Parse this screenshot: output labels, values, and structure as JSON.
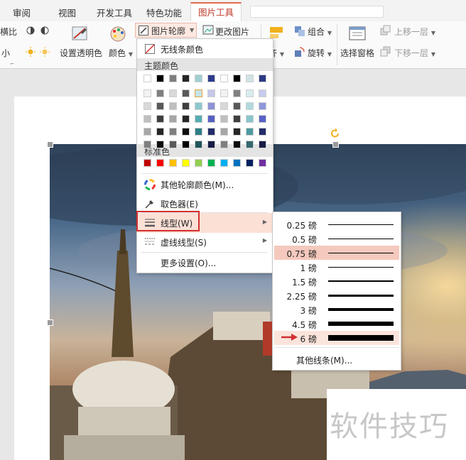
{
  "tabs": [
    "审阅",
    "视图",
    "开发工具",
    "特色功能",
    "图片工具"
  ],
  "active_tab": "图片工具",
  "ribbon": {
    "left_cut_top": "横比",
    "left_cut_bottom": "小",
    "set_transparent": "设置透明色",
    "color": "颜色",
    "outline": "图片轮廓",
    "change_picture": "更改图片",
    "align": "齐",
    "group": "组合",
    "rotate": "旋转",
    "selection_pane": "选择窗格",
    "bring_forward": "上移一层",
    "send_backward": "下移一层"
  },
  "menu": {
    "no_line": "无线条颜色",
    "theme_colors": "主题颜色",
    "standard_colors": "标准色",
    "more_colors": "其他轮廓颜色(M)...",
    "eyedropper": "取色器(E)",
    "line_type": "线型(W)",
    "dash_type": "虚线线型(S)",
    "more_settings": "更多设置(O)..."
  },
  "theme_top_row": [
    "#ffffff",
    "#000000",
    "#7f7f7f",
    "#262626",
    "#9fcfd3",
    "#2e3b8e",
    "#ffffff",
    "#000000",
    "#cfe3e6",
    "#2d3a86"
  ],
  "theme_grid": [
    [
      "#f2f2f2",
      "#7f7f7f",
      "#d9d9d9",
      "#595959",
      "#c6e3e6",
      "#c5c8ea",
      "#f2f2f2",
      "#808080",
      "#d8ecee",
      "#c7cbee"
    ],
    [
      "#d9d9d9",
      "#595959",
      "#bfbfbf",
      "#404040",
      "#8ec8cd",
      "#8c93d6",
      "#d9d9d9",
      "#595959",
      "#b0d9dd",
      "#8f97dc"
    ],
    [
      "#bfbfbf",
      "#3f3f3f",
      "#a6a6a6",
      "#262626",
      "#55acb3",
      "#5560c2",
      "#bfbfbf",
      "#404040",
      "#88c6cc",
      "#5762c8"
    ],
    [
      "#a6a6a6",
      "#262626",
      "#7f7f7f",
      "#0d0d0d",
      "#2f7f86",
      "#232d6b",
      "#a6a6a6",
      "#262626",
      "#4e9aa2",
      "#222c69"
    ],
    [
      "#7f7f7f",
      "#0d0d0d",
      "#595959",
      "#000000",
      "#1f555a",
      "#171e48",
      "#7f7f7f",
      "#0d0d0d",
      "#34686d",
      "#171d46"
    ]
  ],
  "standard_colors_list": [
    "#c00000",
    "#ff0000",
    "#ffc000",
    "#ffff00",
    "#92d050",
    "#00b050",
    "#00b0f0",
    "#0070c0",
    "#002060",
    "#7030a0"
  ],
  "line_weights": [
    {
      "label": "0.25 磅",
      "weight": 0.25
    },
    {
      "label": "0.5 磅",
      "weight": 0.5
    },
    {
      "label": "0.75 磅",
      "weight": 0.75,
      "selected": true
    },
    {
      "label": "1 磅",
      "weight": 1
    },
    {
      "label": "1.5 磅",
      "weight": 1.5
    },
    {
      "label": "2.25 磅",
      "weight": 2.25
    },
    {
      "label": "3 磅",
      "weight": 3
    },
    {
      "label": "4.5 磅",
      "weight": 4.5
    },
    {
      "label": "6 磅",
      "weight": 6,
      "pointed": true
    }
  ],
  "other_lines": "其他线条(M)...",
  "watermark": "软件技巧",
  "colors": {
    "accent_red": "#d32f2f",
    "selected_row": "#f5c9bd",
    "pointed_row": "#fbe4dc"
  }
}
